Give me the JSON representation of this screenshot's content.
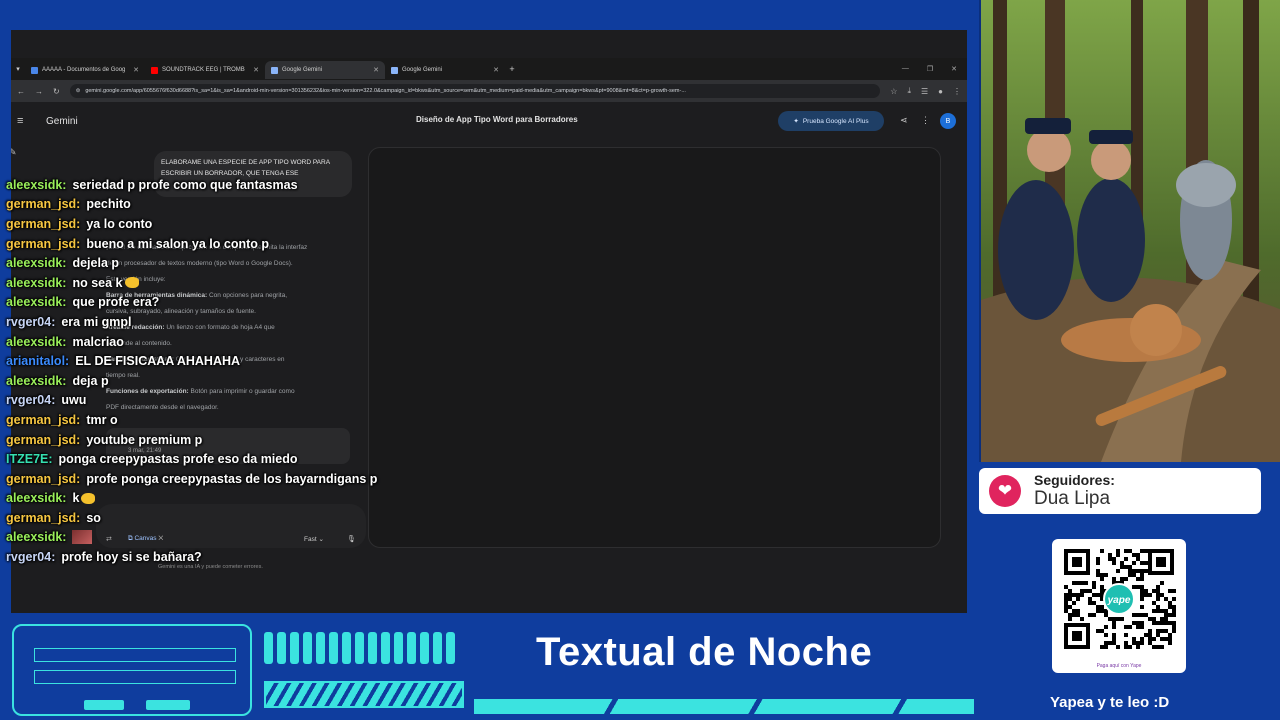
{
  "browser": {
    "tabs": [
      {
        "label": "AAAAA - Documentos de Goog",
        "icon": "docs-icon",
        "color": "#4a86e8"
      },
      {
        "label": "SOUNDTRACK EEG | TROMB",
        "icon": "youtube-icon",
        "color": "#ff0000"
      },
      {
        "label": "Google Gemini",
        "icon": "gemini-icon",
        "color": "#8ab4f8"
      },
      {
        "label": "Google Gemini",
        "icon": "gemini-icon",
        "color": "#8ab4f8"
      }
    ],
    "url": "gemini.google.com/app/6055676f630d6688?is_sa=1&is_sa=1&android-min-version=301356232&ios-min-version=322.0&campaign_id=bkws&utm_source=sem&utm_medium=paid-media&utm_campaign=bkws&pt=9008&mt=8&ct=p-growth-sem-..."
  },
  "gemini": {
    "brand": "Gemini",
    "title": "Diseño de App Tipo Word para Borradores",
    "plus_button": "Prueba Google AI Plus",
    "avatar": "B",
    "user_prompt": "ELABORAME UNA ESPECIE DE APP TIPO WORD PARA ESCRIBIR UN BORRADOR, QUE TENGA ESE",
    "response": [
      {
        "bold": "",
        "text": "¡Claro! He diseñado una aplicación web completa que imita la interfaz"
      },
      {
        "bold": "",
        "text": "de un procesador de textos moderno (tipo Word o Google Docs)."
      },
      {
        "bold": "",
        "text": "Esta versión incluye:"
      },
      {
        "bold": "Barra de herramientas dinámica:",
        "text": " Con opciones para negrita,"
      },
      {
        "bold": "",
        "text": "cursiva, subrayado, alineación y tamaños de fuente."
      },
      {
        "bold": "Área de redacción:",
        "text": " Un lienzo con formato de hoja A4 que"
      },
      {
        "bold": "",
        "text": "responde al contenido."
      },
      {
        "bold": "Panel de estadísticas:",
        "text": " Contador de palabras y caracteres en"
      },
      {
        "bold": "",
        "text": "tiempo real."
      },
      {
        "bold": "Funciones de exportación:",
        "text": " Botón para imprimir o guardar como"
      },
      {
        "bold": "",
        "text": "PDF directamente desde el navegador."
      }
    ],
    "reply_date": "3 mar, 21:49",
    "canvas_chip": "Canvas",
    "model": "Fast",
    "disclaimer": "Gemini es una IA y puede cometer errores."
  },
  "chat": [
    {
      "user": "aleexsidk",
      "color": "#9aef5a",
      "text": "seriedad p profe como que fantasmas"
    },
    {
      "user": "german_jsd",
      "color": "#f7c742",
      "text": "pechito"
    },
    {
      "user": "german_jsd",
      "color": "#f7c742",
      "text": "ya lo conto"
    },
    {
      "user": "german_jsd",
      "color": "#f7c742",
      "text": "bueno a mi salon ya lo conto p"
    },
    {
      "user": "aleexsidk",
      "color": "#9aef5a",
      "text": "dejela p"
    },
    {
      "user": "aleexsidk",
      "color": "#9aef5a",
      "text": "no sea k",
      "emoji": true
    },
    {
      "user": "aleexsidk",
      "color": "#9aef5a",
      "text": "que profe era?"
    },
    {
      "user": "rvger04",
      "color": "#c7d5f5",
      "text": "era mi gmpl"
    },
    {
      "user": "aleexsidk",
      "color": "#9aef5a",
      "text": "malcriao"
    },
    {
      "user": "arianitalol",
      "color": "#3c8cff",
      "text": "EL DE FISICAAA AHAHAHA"
    },
    {
      "user": "aleexsidk",
      "color": "#9aef5a",
      "text": "deja p"
    },
    {
      "user": "rvger04",
      "color": "#c7d5f5",
      "text": "uwu"
    },
    {
      "user": "german_jsd",
      "color": "#f7c742",
      "text": "tmr o"
    },
    {
      "user": "german_jsd",
      "color": "#f7c742",
      "text": "youtube premium p"
    },
    {
      "user": "ITZE7E",
      "color": "#35e0b0",
      "text": "ponga creepypastas profe eso da miedo"
    },
    {
      "user": "german_jsd",
      "color": "#f7c742",
      "text": "profe ponga creepypastas de los bayarndigans p"
    },
    {
      "user": "aleexsidk",
      "color": "#9aef5a",
      "text": "k",
      "emoji": true
    },
    {
      "user": "german_jsd",
      "color": "#f7c742",
      "text": "so"
    },
    {
      "user": "aleexsidk",
      "color": "#9aef5a",
      "text": "",
      "emote": true
    },
    {
      "user": "rvger04",
      "color": "#c7d5f5",
      "text": "profe hoy si se bañara?"
    }
  ],
  "sidebar": {
    "followers_label": "Seguidores:",
    "followers_name": "Dua Lipa",
    "qr_logo": "yape",
    "qr_caption": "Paga aquí con Yape",
    "yape_text": "Yapea y te leo :D"
  },
  "overlay": {
    "title": "Textual de Noche",
    "accent": "#3be3e0",
    "background": "#0f3d9e"
  }
}
